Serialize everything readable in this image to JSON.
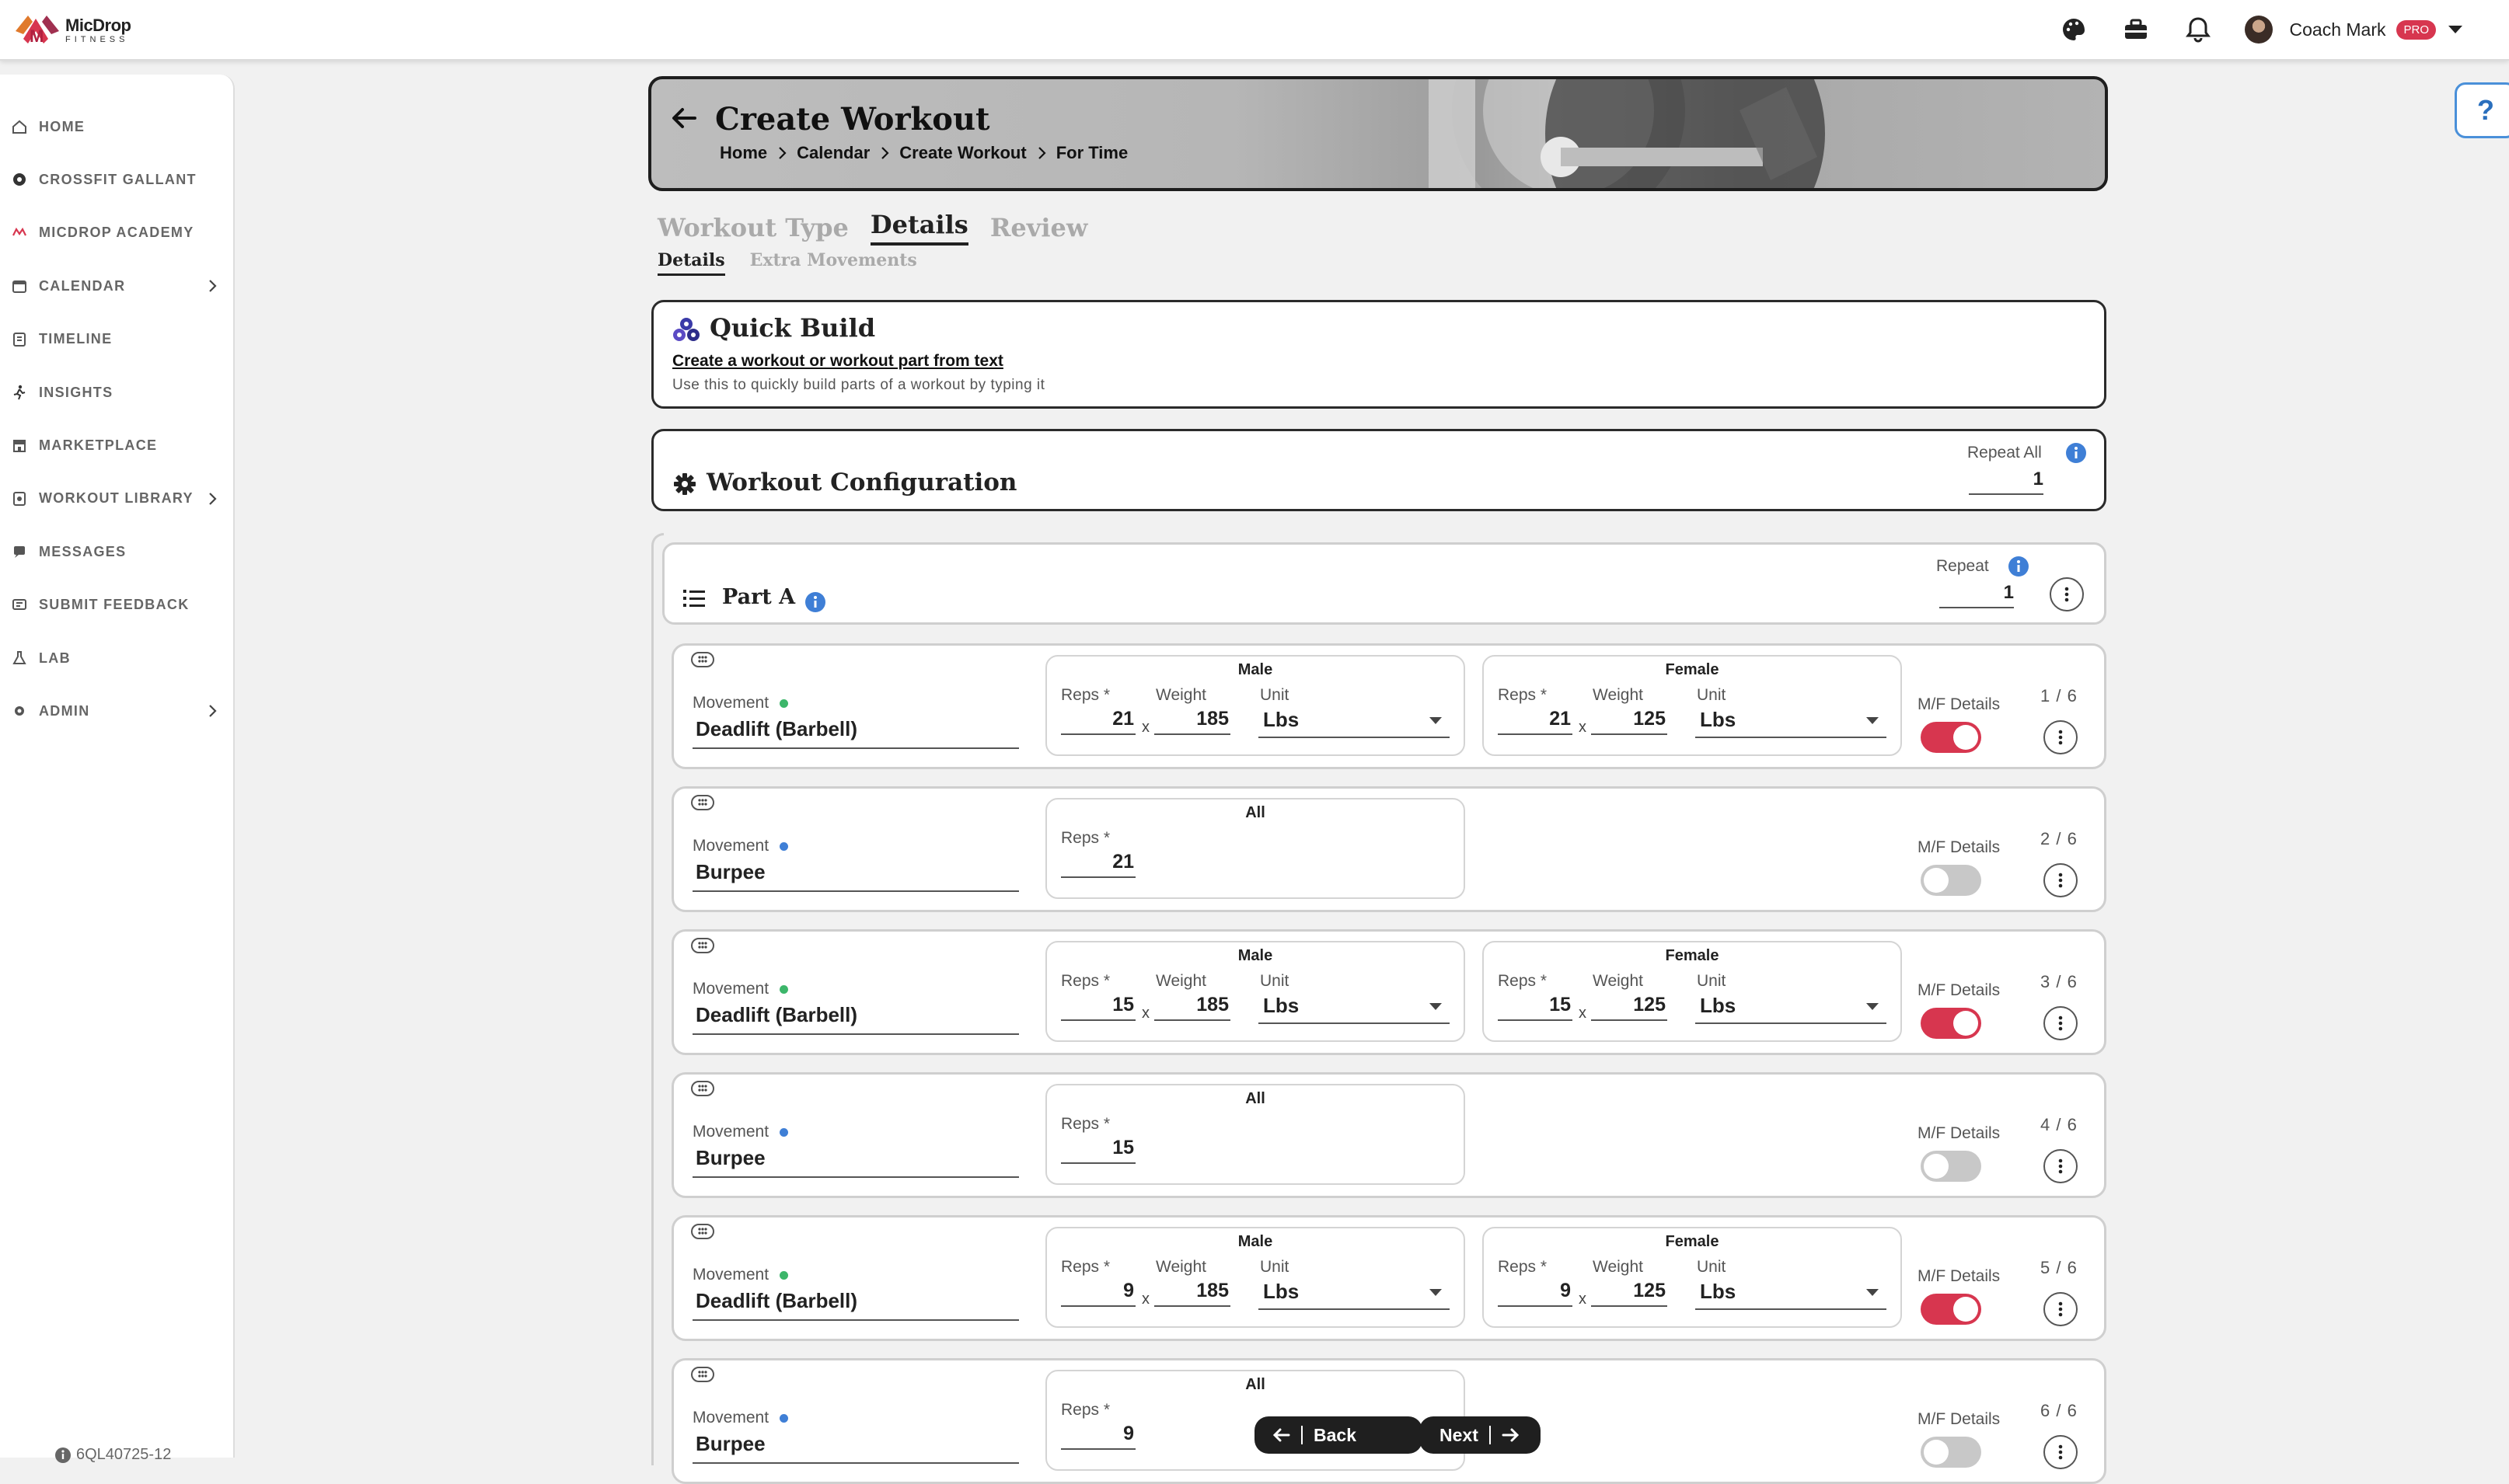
{
  "app": {
    "logo_line1": "MicDrop",
    "logo_line2": "FITNESS"
  },
  "header": {
    "user_name": "Coach Mark",
    "badge": "PRO",
    "icons": [
      "palette-icon",
      "toolbox-icon",
      "bell-icon"
    ]
  },
  "sidebar": {
    "items": [
      {
        "label": "HOME",
        "icon": "home-icon"
      },
      {
        "label": "CROSSFIT GALLANT",
        "icon": "gym-icon"
      },
      {
        "label": "MICDROP ACADEMY",
        "icon": "academy-icon"
      },
      {
        "label": "CALENDAR",
        "icon": "calendar-icon",
        "expand": true
      },
      {
        "label": "TIMELINE",
        "icon": "timeline-icon"
      },
      {
        "label": "INSIGHTS",
        "icon": "runner-icon"
      },
      {
        "label": "MARKETPLACE",
        "icon": "store-icon"
      },
      {
        "label": "WORKOUT LIBRARY",
        "icon": "library-icon",
        "expand": true
      },
      {
        "label": "MESSAGES",
        "icon": "message-icon"
      },
      {
        "label": "SUBMIT FEEDBACK",
        "icon": "feedback-icon"
      },
      {
        "label": "LAB",
        "icon": "flask-icon"
      },
      {
        "label": "ADMIN",
        "icon": "gear-icon",
        "expand": true
      }
    ],
    "version": "6QL40725-12"
  },
  "help": {
    "label": "?"
  },
  "banner": {
    "title": "Create Workout",
    "breadcrumbs": [
      "Home",
      "Calendar",
      "Create Workout",
      "For Time"
    ]
  },
  "tabs": [
    {
      "label": "Workout Type",
      "active": false
    },
    {
      "label": "Details",
      "active": true
    },
    {
      "label": "Review",
      "active": false
    }
  ],
  "subtabs": [
    {
      "label": "Details",
      "active": true
    },
    {
      "label": "Extra Movements",
      "active": false
    }
  ],
  "quick_build": {
    "title": "Quick Build",
    "link": "Create a workout or workout part from text",
    "subtitle": "Use this to quickly build parts of a workout by typing it"
  },
  "config": {
    "title": "Workout Configuration",
    "repeat_all_label": "Repeat All",
    "repeat_all_value": "1"
  },
  "part": {
    "title": "Part A",
    "repeat_label": "Repeat",
    "repeat_value": "1"
  },
  "labels": {
    "movement": "Movement",
    "male": "Male",
    "female": "Female",
    "all": "All",
    "reps": "Reps *",
    "weight": "Weight",
    "unit": "Unit",
    "x": "x",
    "mf": "M/F Details"
  },
  "movements": [
    {
      "name": "Deadlift (Barbell)",
      "dot": "#3cb66a",
      "gendered": true,
      "male_reps": "21",
      "male_weight": "185",
      "male_unit": "Lbs",
      "female_reps": "21",
      "female_weight": "125",
      "female_unit": "Lbs",
      "mf_on": true,
      "index": "1 / 6"
    },
    {
      "name": "Burpee",
      "dot": "#3f7fd6",
      "gendered": false,
      "reps": "21",
      "mf_on": false,
      "index": "2 / 6"
    },
    {
      "name": "Deadlift (Barbell)",
      "dot": "#3cb66a",
      "gendered": true,
      "male_reps": "15",
      "male_weight": "185",
      "male_unit": "Lbs",
      "female_reps": "15",
      "female_weight": "125",
      "female_unit": "Lbs",
      "mf_on": true,
      "index": "3 / 6"
    },
    {
      "name": "Burpee",
      "dot": "#3f7fd6",
      "gendered": false,
      "reps": "15",
      "mf_on": false,
      "index": "4 / 6"
    },
    {
      "name": "Deadlift (Barbell)",
      "dot": "#3cb66a",
      "gendered": true,
      "male_reps": "9",
      "male_weight": "185",
      "male_unit": "Lbs",
      "female_reps": "9",
      "female_weight": "125",
      "female_unit": "Lbs",
      "mf_on": true,
      "index": "5 / 6"
    },
    {
      "name": "Burpee",
      "dot": "#3f7fd6",
      "gendered": false,
      "reps": "9",
      "mf_on": false,
      "index": "6 / 6"
    }
  ],
  "footer": {
    "back_label": "Back",
    "next_label": "Next"
  },
  "colors": {
    "accent_red": "#d7364f",
    "info_blue": "#3f7fd6"
  }
}
